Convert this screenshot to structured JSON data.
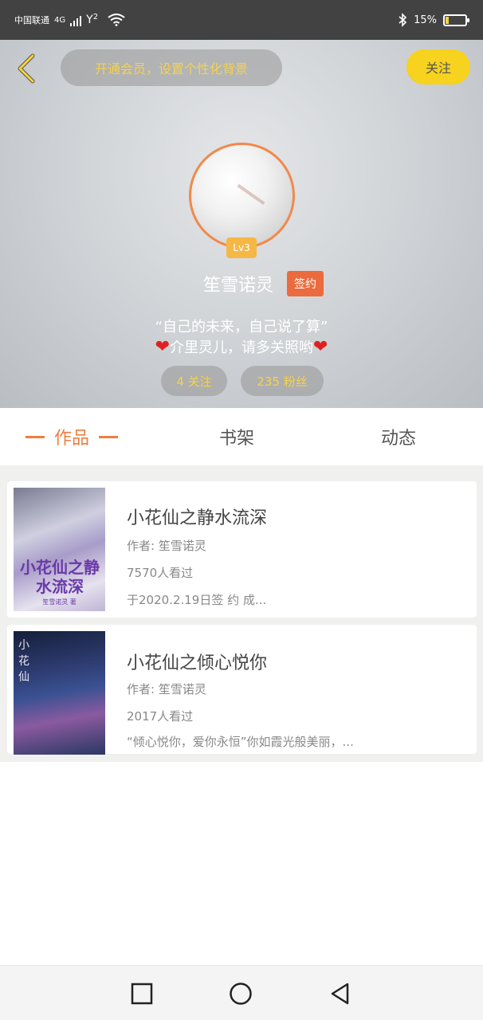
{
  "status_bar": {
    "carrier": "中国联通",
    "network": "4G",
    "sim2": "2",
    "battery": "15%",
    "battery_level": 0.15
  },
  "header": {
    "vip_label": "开通会员，设置个性化背景",
    "follow_label": "关注",
    "level": "Lv3",
    "username": "笙雪诺灵",
    "signed_badge": "签约",
    "bio_line1": "“自己的未来，自己说了算”",
    "bio_line2": "介里灵儿，请多关照哟",
    "following": "4 关注",
    "fans": "235 粉丝"
  },
  "tabs": [
    {
      "label": "作品",
      "active": true
    },
    {
      "label": "书架",
      "active": false
    },
    {
      "label": "动态",
      "active": false
    }
  ],
  "books": [
    {
      "title": "小花仙之静水流深",
      "author": "作者: 笙雪诺灵",
      "views": "7570人看过",
      "desc": "于2020.2.19日签 约 成...",
      "cover_text": "小花仙之静水流深",
      "cover_author": "笙雪诺灵 著"
    },
    {
      "title": "小花仙之倾心悦你",
      "author": "作者: 笙雪诺灵",
      "views": "2017人看过",
      "desc": "“倾心悦你，爱你永恒”你如霞光般美丽，...",
      "cover_text": "小花仙"
    }
  ],
  "colors": {
    "accent_orange": "#ef7e3f",
    "yellow": "#f7d21e",
    "badge_orange": "#ec6b3e"
  }
}
